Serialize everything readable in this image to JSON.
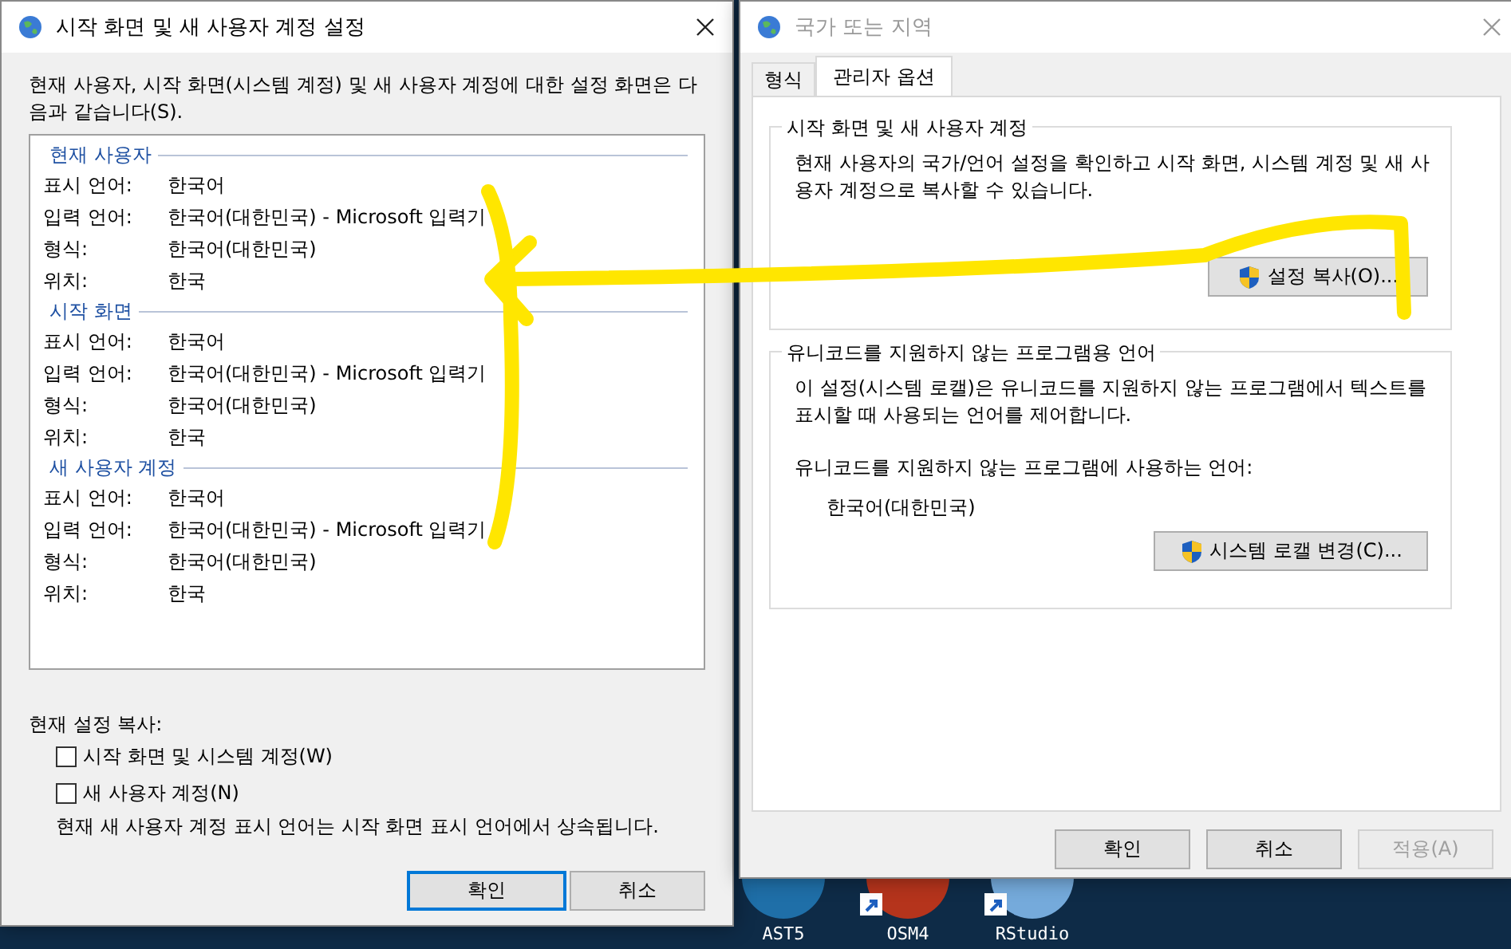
{
  "desktop_icons": [
    {
      "label": "AST5",
      "color": "#1f6fa8",
      "shortcut": false
    },
    {
      "label": "OSM4",
      "color": "#b5341c",
      "shortcut": true
    },
    {
      "label": "RStudio",
      "color": "#75aadb",
      "shortcut": true
    }
  ],
  "settings_dialog": {
    "title": "시작 화면 및 새 사용자 계정 설정",
    "intro": "현재 사용자, 시작 화면(시스템 계정) 및 새 사용자 계정에 대한 설정 화면은 다음과 같습니다(S).",
    "sections": [
      {
        "heading": "현재 사용자",
        "rows": [
          {
            "label": "표시 언어:",
            "value": "한국어"
          },
          {
            "label": "입력 언어:",
            "value": "한국어(대한민국) - Microsoft 입력기"
          },
          {
            "label": "형식:",
            "value": "한국어(대한민국)"
          },
          {
            "label": "위치:",
            "value": "한국"
          }
        ]
      },
      {
        "heading": "시작 화면",
        "rows": [
          {
            "label": "표시 언어:",
            "value": "한국어"
          },
          {
            "label": "입력 언어:",
            "value": "한국어(대한민국) - Microsoft 입력기"
          },
          {
            "label": "형식:",
            "value": "한국어(대한민국)"
          },
          {
            "label": "위치:",
            "value": "한국"
          }
        ]
      },
      {
        "heading": "새 사용자 계정",
        "rows": [
          {
            "label": "표시 언어:",
            "value": "한국어"
          },
          {
            "label": "입력 언어:",
            "value": "한국어(대한민국) - Microsoft 입력기"
          },
          {
            "label": "형식:",
            "value": "한국어(대한민국)"
          },
          {
            "label": "위치:",
            "value": "한국"
          }
        ]
      }
    ],
    "copy_label": "현재 설정 복사:",
    "checkboxes": [
      {
        "label": "시작 화면 및 시스템 계정(W)",
        "checked": false
      },
      {
        "label": "새 사용자 계정(N)",
        "checked": false
      }
    ],
    "note": "현재 새 사용자 계정 표시 언어는 시작 화면 표시 언어에서 상속됩니다.",
    "buttons": [
      {
        "label": "확인",
        "default": true
      },
      {
        "label": "취소",
        "default": false
      }
    ]
  },
  "region_dialog": {
    "title": "국가 또는 지역",
    "active": false,
    "tabs": [
      {
        "label": "형식",
        "selected": false
      },
      {
        "label": "관리자 옵션",
        "selected": true
      }
    ],
    "welcome_group": {
      "title": "시작 화면 및 새 사용자 계정",
      "description": "현재 사용자의 국가/언어 설정을 확인하고 시작 화면, 시스템 계정 및 새 사용자 계정으로 복사할 수 있습니다.",
      "button": "설정 복사(O)..."
    },
    "unicode_group": {
      "title": "유니코드를 지원하지 않는 프로그램용 언어",
      "description": "이 설정(시스템 로캘)은 유니코드를 지원하지 않는 프로그램에서 텍스트를 표시할 때 사용되는 언어를 제어합니다.",
      "prompt": "유니코드를 지원하지 않는 프로그램에 사용하는 언어:",
      "current": "한국어(대한민국)",
      "button": "시스템 로캘 변경(C)..."
    },
    "buttons": [
      {
        "label": "확인",
        "disabled": false
      },
      {
        "label": "취소",
        "disabled": false
      },
      {
        "label": "적용(A)",
        "disabled": true
      }
    ]
  }
}
